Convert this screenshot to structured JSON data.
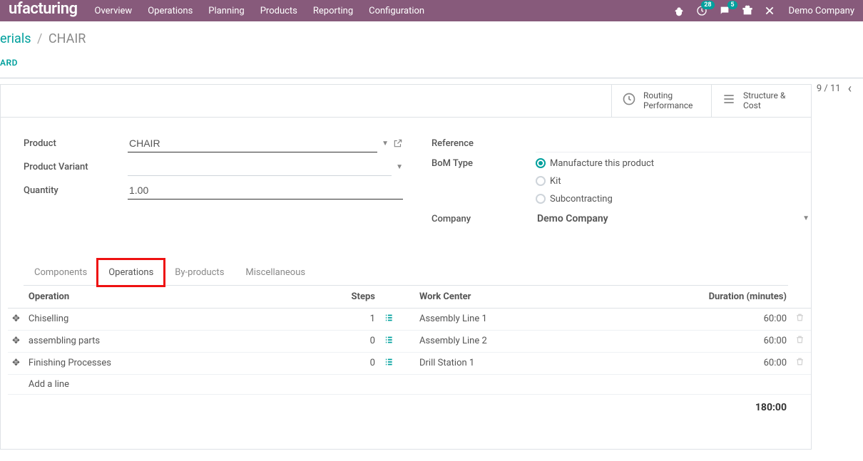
{
  "topbar": {
    "brand": "ufacturing",
    "nav": [
      "Overview",
      "Operations",
      "Planning",
      "Products",
      "Reporting",
      "Configuration"
    ],
    "badge_activities": "28",
    "badge_messages": "5",
    "company": "Demo Company"
  },
  "breadcrumb": {
    "prev": "erials",
    "current": "CHAIR"
  },
  "action_label": "ARD",
  "pager": {
    "text": "9 / 11"
  },
  "stats": {
    "routing": {
      "l1": "Routing",
      "l2": "Performance"
    },
    "structure": {
      "l1": "Structure &",
      "l2": "Cost"
    }
  },
  "form": {
    "product_label": "Product",
    "product_value": "CHAIR",
    "variant_label": "Product Variant",
    "variant_value": "",
    "quantity_label": "Quantity",
    "quantity_value": "1.00",
    "reference_label": "Reference",
    "bom_type_label": "BoM Type",
    "bom_opts": {
      "manufacture": "Manufacture this product",
      "kit": "Kit",
      "sub": "Subcontracting"
    },
    "company_label": "Company",
    "company_value": "Demo Company"
  },
  "tabs": {
    "components": "Components",
    "operations": "Operations",
    "byproducts": "By-products",
    "misc": "Miscellaneous"
  },
  "table": {
    "headers": {
      "operation": "Operation",
      "steps": "Steps",
      "workcenter": "Work Center",
      "duration": "Duration (minutes)"
    },
    "rows": [
      {
        "op": "Chiselling",
        "steps": "1",
        "wc": "Assembly Line 1",
        "dur": "60:00"
      },
      {
        "op": "assembling parts",
        "steps": "0",
        "wc": "Assembly Line 2",
        "dur": "60:00"
      },
      {
        "op": "Finishing Processes",
        "steps": "0",
        "wc": "Drill Station 1",
        "dur": "60:00"
      }
    ],
    "add_line": "Add a line",
    "total": "180:00"
  }
}
